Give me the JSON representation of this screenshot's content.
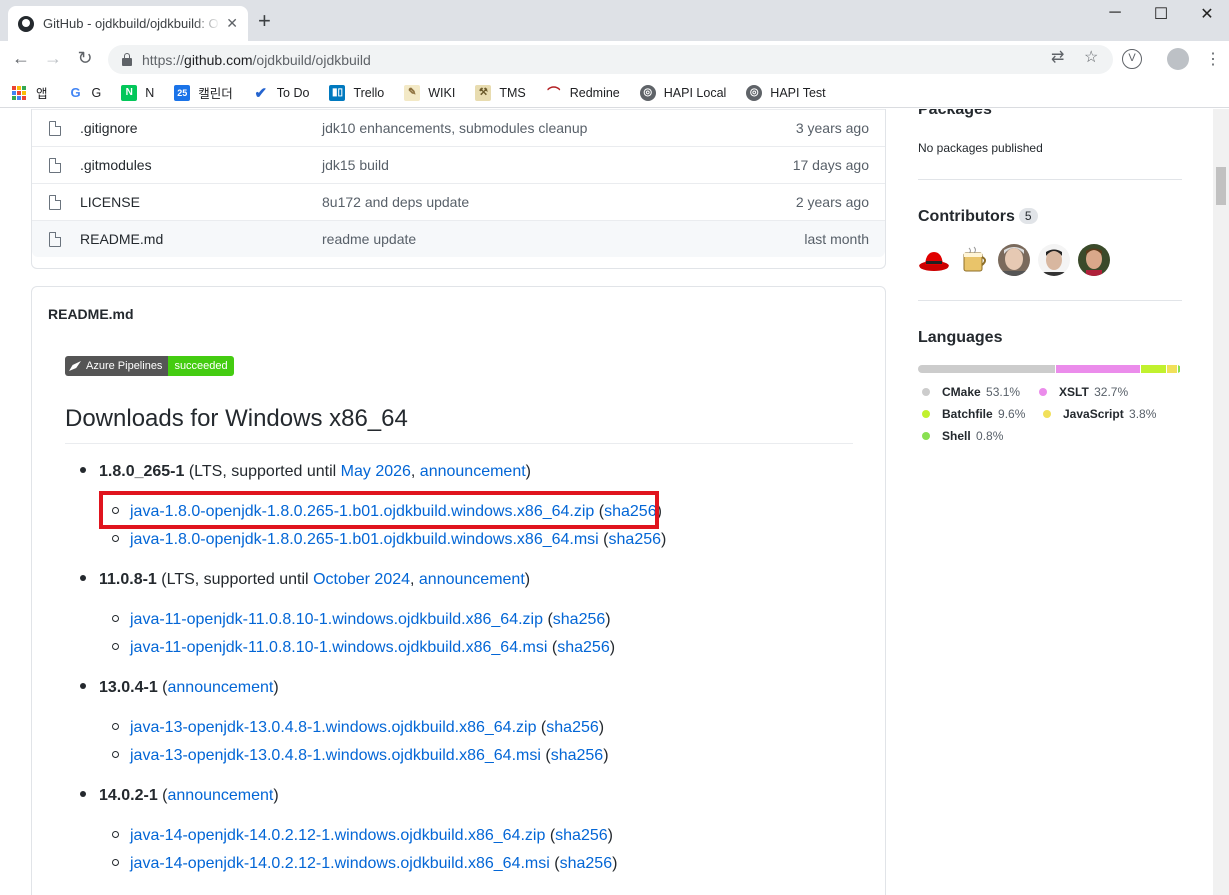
{
  "browser": {
    "tab_title": "GitHub - ojdkbuild/ojdkbuild: O",
    "url_proto": "https://",
    "url_host": "github.com",
    "url_path": "/ojdkbuild/ojdkbuild",
    "bookmarks": [
      {
        "label": "앱",
        "color": "#ea4335"
      },
      {
        "label": "G",
        "color": "#4285f4"
      },
      {
        "label": "N",
        "color": "#03c75a"
      },
      {
        "label": "캘린더",
        "color": "#1a73e8"
      },
      {
        "label": "To Do",
        "color": "#2564cf"
      },
      {
        "label": "Trello",
        "color": "#0079bf"
      },
      {
        "label": "WIKI",
        "color": "#8a6d3b"
      },
      {
        "label": "TMS",
        "color": "#6b5a2b"
      },
      {
        "label": "Redmine",
        "color": "#b32024"
      },
      {
        "label": "HAPI Local",
        "color": "#5f6368"
      },
      {
        "label": "HAPI Test",
        "color": "#5f6368"
      }
    ]
  },
  "files": [
    {
      "name": ".gitignore",
      "message": "jdk10 enhancements, submodules cleanup",
      "age": "3 years ago"
    },
    {
      "name": ".gitmodules",
      "message": "jdk15 build",
      "age": "17 days ago"
    },
    {
      "name": "LICENSE",
      "message": "8u172 and deps update",
      "age": "2 years ago"
    },
    {
      "name": "README.md",
      "message": "readme update",
      "age": "last month"
    }
  ],
  "readme": {
    "header": "README.md",
    "badge_left": "Azure Pipelines",
    "badge_right": "succeeded",
    "heading": "Downloads for Windows x86_64",
    "releases": [
      {
        "version": "1.8.0_265-1",
        "pre": " (LTS, supported until ",
        "until": "May 2026",
        "comma": ", ",
        "announce": "announcement",
        "post": ")",
        "downloads": [
          {
            "file": "java-1.8.0-openjdk-1.8.0.265-1.b01.ojdkbuild.windows.x86_64.zip",
            "sha": "sha256"
          },
          {
            "file": "java-1.8.0-openjdk-1.8.0.265-1.b01.ojdkbuild.windows.x86_64.msi",
            "sha": "sha256"
          }
        ]
      },
      {
        "version": "11.0.8-1",
        "pre": " (LTS, supported until ",
        "until": "October 2024",
        "comma": ", ",
        "announce": "announcement",
        "post": ")",
        "downloads": [
          {
            "file": "java-11-openjdk-11.0.8.10-1.windows.ojdkbuild.x86_64.zip",
            "sha": "sha256"
          },
          {
            "file": "java-11-openjdk-11.0.8.10-1.windows.ojdkbuild.x86_64.msi",
            "sha": "sha256"
          }
        ]
      },
      {
        "version": "13.0.4-1",
        "pre": " (",
        "until": "",
        "comma": "",
        "announce": "announcement",
        "post": ")",
        "downloads": [
          {
            "file": "java-13-openjdk-13.0.4.8-1.windows.ojdkbuild.x86_64.zip",
            "sha": "sha256"
          },
          {
            "file": "java-13-openjdk-13.0.4.8-1.windows.ojdkbuild.x86_64.msi",
            "sha": "sha256"
          }
        ]
      },
      {
        "version": "14.0.2-1",
        "pre": " (",
        "until": "",
        "comma": "",
        "announce": "announcement",
        "post": ")",
        "downloads": [
          {
            "file": "java-14-openjdk-14.0.2.12-1.windows.ojdkbuild.x86_64.zip",
            "sha": "sha256"
          },
          {
            "file": "java-14-openjdk-14.0.2.12-1.windows.ojdkbuild.x86_64.msi",
            "sha": "sha256"
          }
        ]
      }
    ]
  },
  "sidebar": {
    "packages_title": "Packages",
    "packages_text": "No packages published",
    "contributors_title": "Contributors",
    "contributors_count": "5",
    "languages_title": "Languages",
    "languages": [
      {
        "name": "CMake",
        "pct": "53.1%",
        "value": 53.1,
        "color": "#cccccc"
      },
      {
        "name": "XSLT",
        "pct": "32.7%",
        "value": 32.7,
        "color": "#eb8ceb"
      },
      {
        "name": "Batchfile",
        "pct": "9.6%",
        "value": 9.6,
        "color": "#c1f12e"
      },
      {
        "name": "JavaScript",
        "pct": "3.8%",
        "value": 3.8,
        "color": "#f1e05a"
      },
      {
        "name": "Shell",
        "pct": "0.8%",
        "value": 0.8,
        "color": "#89e051"
      }
    ]
  }
}
